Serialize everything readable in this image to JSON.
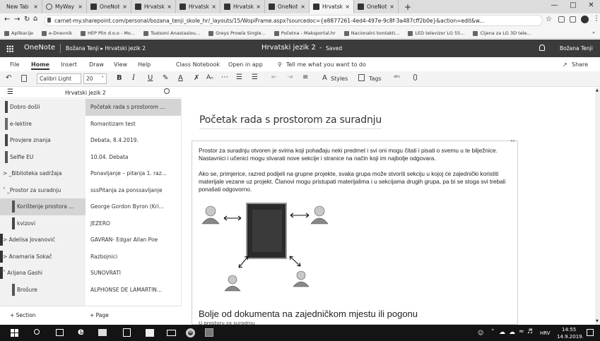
{
  "browser": {
    "tabs": [
      {
        "label": "New Tab",
        "icon": "none"
      },
      {
        "label": "MyWay",
        "icon": "myway-icon"
      },
      {
        "label": "OneNote",
        "icon": "onenote-icon"
      },
      {
        "label": "Hrvatski jez",
        "icon": "onenote-icon"
      },
      {
        "label": "Hrvatski jez",
        "icon": "onenote-icon"
      },
      {
        "label": "Hrvatski jez",
        "icon": "onenote-icon"
      },
      {
        "label": "OneNote C",
        "icon": "onenote-icon"
      },
      {
        "label": "Hrvatski jez",
        "icon": "onenote-icon",
        "active": true
      },
      {
        "label": "OneNote C",
        "icon": "onenote-icon"
      }
    ],
    "new_tab": "+",
    "url": "carnet-my.sharepoint.com/personal/bozana_tenji_skole_hr/_layouts/15/WopiFrame.aspx?sourcedoc={e8877261-4ed4-497e-9c8f-3a487cff2b0e}&action=edit&w...",
    "bookmarks": [
      "Aplikacije",
      "e-Dnevnik",
      "HEP Plin d.o.o - Mo...",
      "Tsatsoni Anastasiou...",
      "Greys Prowla Single...",
      "Početna - Maksportal.hr",
      "Nacionalni kontakti...",
      "LED televizor LG 55...",
      "Cijena za LG 3D tele..."
    ],
    "bookmarks_more": "»"
  },
  "onenote": {
    "app_name": "OneNote",
    "breadcrumb": "Božana Tenji ▸ Hrvatski jezik 2",
    "doc_title": "Hrvatski jezik 2",
    "saved": "Saved",
    "user": "Božana Tenji"
  },
  "ribbon": {
    "tabs": [
      "File",
      "Home",
      "Insert",
      "Draw",
      "View",
      "Help",
      "Class Notebook",
      "Open in app"
    ],
    "tell_me": "Tell me what you want to do",
    "share": "Share",
    "font": "Calibri Light",
    "size": "20",
    "styles": "Styles",
    "tags": "Tags"
  },
  "nav": {
    "notebook": "Hrvatski jezik 2",
    "sections": [
      {
        "label": "Dobro došli",
        "color": "#444444"
      },
      {
        "label": "e-lektire",
        "color": "#6a6a6a"
      },
      {
        "label": "Provjere znanja",
        "color": "#444444"
      },
      {
        "label": "Selfie EU",
        "color": "#555555"
      },
      {
        "label": "> _Biblioteka sadržaja",
        "color": ""
      },
      {
        "label": "˅ _Prostor za suradnju",
        "color": ""
      },
      {
        "label": "Korištenje prostora ...",
        "color": "#555555",
        "selected": true
      },
      {
        "label": "kvizovi",
        "color": "#444444"
      },
      {
        "label": "> Adelisa Jovanović",
        "color": "#333333"
      },
      {
        "label": "> Anamaria Sokač",
        "color": "#333333"
      },
      {
        "label": "˅ Arijana Gashi",
        "color": "#333333"
      },
      {
        "label": "Brošure",
        "color": "#555555"
      }
    ],
    "pages": [
      {
        "label": "Početak rada s prostorom ...",
        "selected": true
      },
      {
        "label": "Romantizam test"
      },
      {
        "label": "Debata, 8.4.2019."
      },
      {
        "label": "10.04. Debata"
      },
      {
        "label": "Ponavljanje – pitanja 1. raz..."
      },
      {
        "label": "sssPitanja za ponssavljanje"
      },
      {
        "label": "George Gordon Byron (Kri..."
      },
      {
        "label": "JEZERO"
      },
      {
        "label": "GAVRAN- Edgar Allan Poe"
      },
      {
        "label": "Razbojnici"
      },
      {
        "label": "SUNOVRATI"
      },
      {
        "label": "ALPHONSE DE LAMARTIN..."
      }
    ],
    "add_section": "+ Section",
    "add_page": "+ Page"
  },
  "page": {
    "title": "Početak rada s prostorom za suradnju",
    "para1": "Prostor za suradnju otvoren je svima koji pohađaju neki predmet i svi oni mogu čitati i pisati o svemu u te bilježnice. Nastavnici i učenici mogu stvarati nove sekcije i stranice na način koji im najbolje odgovara.",
    "para2": "Ako se, primjerice, razred podijeli na grupne projekte, svaka grupa može stvoriti sekciju u kojoj će zajednički koristiti materijale vezane uz projekt. Članovi mogu pristupati materijalima i u sekcijama drugih grupa, pa bi se stoga svi trebali ponašati odgovorno.",
    "heading2": "Bolje od dokumenta na zajedničkom mjestu ili pogonu",
    "cut": "U prostoru za suradnju"
  },
  "taskbar": {
    "lang": "HRV",
    "time": "14:55",
    "date": "14.9.2019."
  }
}
